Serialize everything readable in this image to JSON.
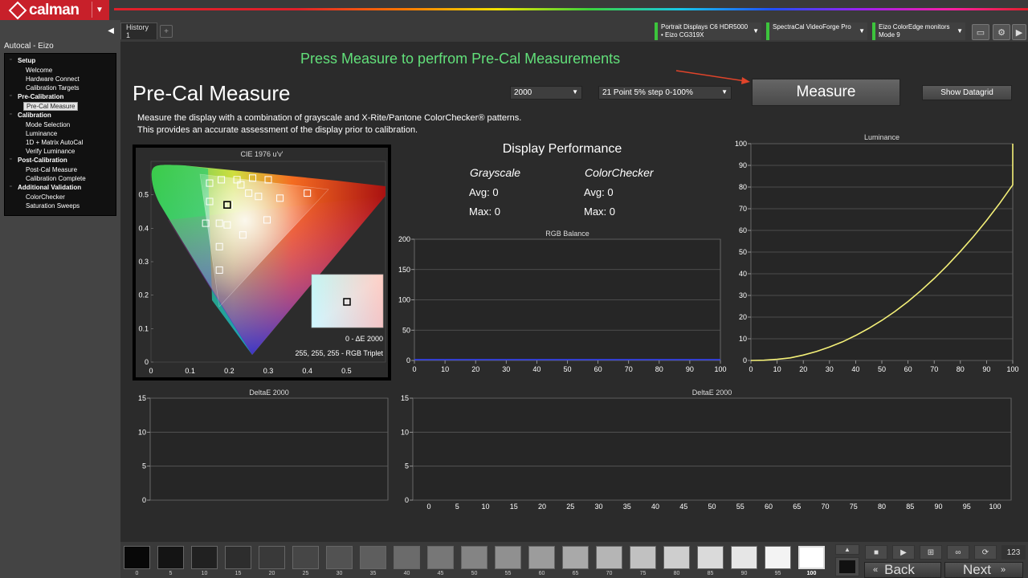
{
  "app": {
    "brand": "calman",
    "brand_color": "#c8202a",
    "accent_green": "#62e07a"
  },
  "sidebar": {
    "project_title": "Autocal - Eizo",
    "sections": [
      {
        "label": "Setup",
        "items": [
          "Welcome",
          "Hardware Connect",
          "Calibration Targets"
        ]
      },
      {
        "label": "Pre-Calibration",
        "items": [
          "Pre-Cal Measure"
        ]
      },
      {
        "label": "Calibration",
        "items": [
          "Mode Selection",
          "Luminance",
          "1D + Matrix AutoCal",
          "Verify Luminance"
        ]
      },
      {
        "label": "Post-Calibration",
        "items": [
          "Post-Cal Measure",
          "Calibration Complete"
        ]
      },
      {
        "label": "Additional Validation",
        "items": [
          "ColorChecker",
          "Saturation Sweeps"
        ]
      }
    ],
    "selected": "Pre-Cal Measure"
  },
  "tabs": {
    "history": "History 1",
    "add": "+"
  },
  "devices": [
    {
      "line1": "Portrait Displays C6 HDR5000",
      "line2": "• Eizo CG319X"
    },
    {
      "line1": "SpectraCal VideoForge Pro",
      "line2": ""
    },
    {
      "line1": "Eizo ColorEdge monitors",
      "line2": "Mode 9"
    }
  ],
  "header": {
    "instruction": "Press Measure to perfrom Pre-Cal Measurements",
    "title": "Pre-Cal Measure",
    "desc1": "Measure the display with a combination of grayscale and X-Rite/Pantone ColorChecker® patterns.",
    "desc2": "This provides an accurate assessment of the display prior to calibration."
  },
  "controls": {
    "de_select": "2000",
    "point_select": "21 Point 5% step 0-100%",
    "measure": "Measure",
    "show_datagrid": "Show Datagrid"
  },
  "cie": {
    "title": "CIE 1976 u'v'",
    "de_label": "0 - ΔE 2000",
    "rgb_label": "255, 255, 255 - RGB Triplet",
    "x_ticks": [
      "0",
      "0.1",
      "0.2",
      "0.3",
      "0.4",
      "0.5"
    ],
    "y_ticks": [
      "0.5",
      "0.4",
      "0.3",
      "0.2",
      "0.1",
      "0"
    ]
  },
  "performance": {
    "title": "Display Performance",
    "grayscale": {
      "label": "Grayscale",
      "avg": "Avg: 0",
      "max": "Max: 0"
    },
    "colorchecker": {
      "label": "ColorChecker",
      "avg": "Avg: 0",
      "max": "Max: 0"
    }
  },
  "chart_data": [
    {
      "type": "scatter",
      "title": "CIE 1976 u'v'",
      "xlim": [
        0,
        0.6
      ],
      "ylim": [
        0,
        0.6
      ],
      "points": [
        [
          0.15,
          0.535
        ],
        [
          0.18,
          0.545
        ],
        [
          0.22,
          0.545
        ],
        [
          0.26,
          0.55
        ],
        [
          0.3,
          0.545
        ],
        [
          0.23,
          0.53
        ],
        [
          0.25,
          0.505
        ],
        [
          0.275,
          0.495
        ],
        [
          0.2,
          0.47
        ],
        [
          0.15,
          0.48
        ],
        [
          0.33,
          0.49
        ],
        [
          0.4,
          0.505
        ],
        [
          0.14,
          0.415
        ],
        [
          0.175,
          0.415
        ],
        [
          0.195,
          0.41
        ],
        [
          0.235,
          0.38
        ],
        [
          0.297,
          0.425
        ],
        [
          0.175,
          0.345
        ],
        [
          0.175,
          0.275
        ],
        [
          0.195,
          0.47
        ]
      ]
    },
    {
      "type": "line",
      "title": "RGB Balance",
      "x_ticks": [
        "0",
        "10",
        "20",
        "30",
        "40",
        "50",
        "60",
        "70",
        "80",
        "90",
        "100"
      ],
      "y_ticks": [
        "0",
        "50",
        "100",
        "150",
        "200"
      ],
      "xlim": [
        0,
        100
      ],
      "ylim": [
        0,
        200
      ],
      "series": []
    },
    {
      "type": "line",
      "title": "Luminance",
      "x_ticks": [
        "0",
        "10",
        "20",
        "30",
        "40",
        "50",
        "60",
        "70",
        "80",
        "90",
        "100"
      ],
      "y_ticks": [
        "0",
        "10",
        "20",
        "30",
        "40",
        "50",
        "60",
        "70",
        "80",
        "90",
        "100"
      ],
      "xlim": [
        0,
        100
      ],
      "ylim": [
        0,
        100
      ],
      "series": [
        {
          "x": [
            0,
            5,
            10,
            15,
            20,
            25,
            30,
            35,
            40,
            45,
            50,
            55,
            60,
            65,
            70,
            75,
            80,
            85,
            90,
            95,
            100
          ],
          "y": [
            0,
            0.1,
            0.5,
            1.2,
            2.5,
            4.1,
            6.2,
            8.6,
            11.5,
            14.8,
            18.5,
            22.6,
            27.2,
            32.3,
            37.8,
            43.8,
            50.3,
            57.2,
            64.6,
            72.5,
            81
          ]
        }
      ]
    },
    {
      "type": "bar",
      "title": "DeltaE 2000",
      "y_ticks": [
        "0",
        "5",
        "10",
        "15"
      ],
      "ylim": [
        0,
        15
      ],
      "values": []
    },
    {
      "type": "bar",
      "title": "DeltaE 2000",
      "categories": [
        "0",
        "5",
        "10",
        "15",
        "20",
        "25",
        "30",
        "35",
        "40",
        "45",
        "50",
        "55",
        "60",
        "65",
        "70",
        "75",
        "80",
        "85",
        "90",
        "95",
        "100"
      ],
      "y_ticks": [
        "0",
        "5",
        "10",
        "15"
      ],
      "ylim": [
        0,
        15
      ],
      "values": []
    }
  ],
  "swatches": {
    "labels": [
      "0",
      "5",
      "10",
      "15",
      "20",
      "25",
      "30",
      "35",
      "40",
      "45",
      "50",
      "55",
      "60",
      "65",
      "70",
      "75",
      "80",
      "85",
      "90",
      "95",
      "100"
    ],
    "selected": "100"
  },
  "footer": {
    "back": "Back",
    "next": "Next",
    "counter": "123"
  }
}
